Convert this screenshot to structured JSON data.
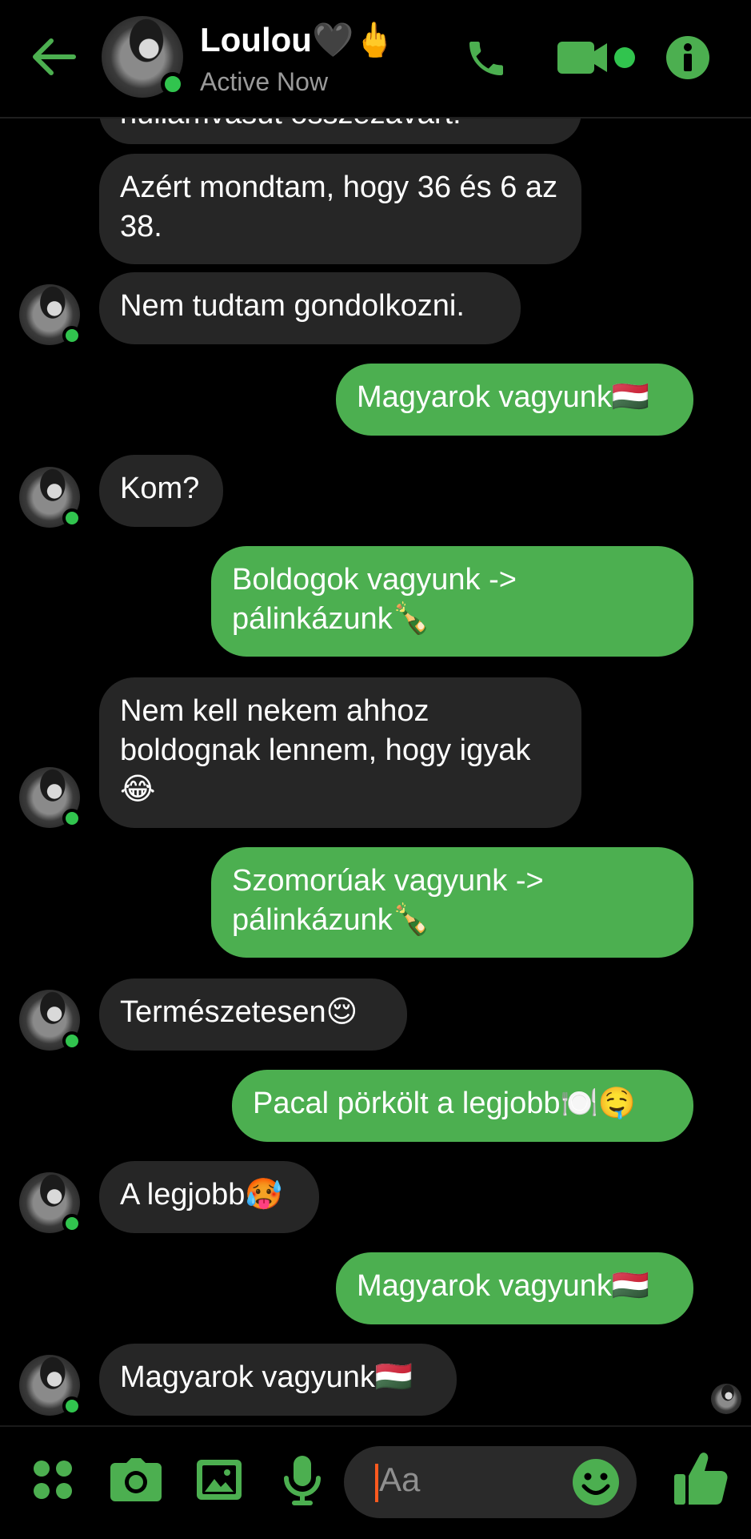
{
  "header": {
    "contact_name": "Loulou🖤🖕",
    "status": "Active Now",
    "icons": {
      "back": "arrow-left-icon",
      "call": "phone-icon",
      "video": "video-camera-icon",
      "info": "info-icon"
    }
  },
  "colors": {
    "accent": "#4caf50",
    "online": "#31c44e",
    "incoming_bubble": "#262626",
    "background": "#000000",
    "caret": "#ff5a1f"
  },
  "messages": [
    {
      "sender": "contact",
      "text": "hullámvasút összezavart!"
    },
    {
      "sender": "contact",
      "text": "Azért mondtam, hogy 36 és 6 az 38."
    },
    {
      "sender": "contact",
      "text": "Nem tudtam gondolkozni."
    },
    {
      "sender": "me",
      "text": "Magyarok vagyunk🇭🇺"
    },
    {
      "sender": "contact",
      "text": "Kom?"
    },
    {
      "sender": "me",
      "text": "Boldogok vagyunk -> pálinkázunk🍾"
    },
    {
      "sender": "contact",
      "text": "Nem kell nekem ahhoz boldognak lennem, hogy igyak😂"
    },
    {
      "sender": "me",
      "text": "Szomorúak vagyunk -> pálinkázunk🍾"
    },
    {
      "sender": "contact",
      "text": "Természetesen😌"
    },
    {
      "sender": "me",
      "text": "Pacal pörkölt a legjobb🍽️🤤"
    },
    {
      "sender": "contact",
      "text": "A legjobb🥵"
    },
    {
      "sender": "me",
      "text": "Magyarok vagyunk🇭🇺"
    },
    {
      "sender": "contact",
      "text": "Magyarok vagyunk🇭🇺"
    }
  ],
  "composer": {
    "placeholder": "Aa",
    "icons": {
      "more": "four-dots-icon",
      "camera": "camera-icon",
      "gallery": "image-icon",
      "mic": "microphone-icon",
      "emoji": "smiley-icon",
      "like": "thumbs-up-icon"
    }
  }
}
